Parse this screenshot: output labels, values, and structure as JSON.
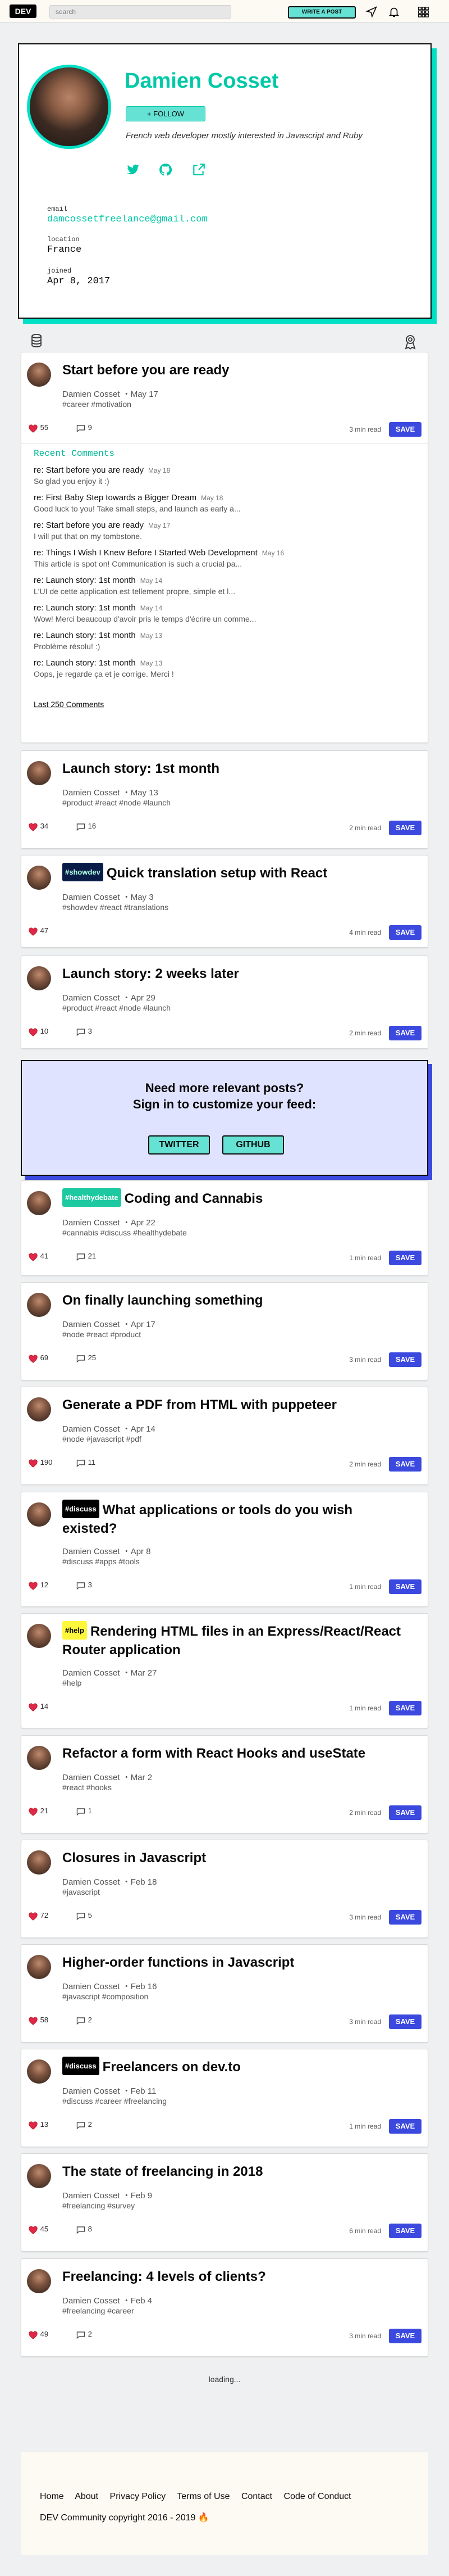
{
  "topbar": {
    "logo": "DEV",
    "search_placeholder": "search",
    "write_post": "WRITE A POST"
  },
  "profile": {
    "name": "Damien Cosset",
    "follow": "+ FOLLOW",
    "bio": "French web developer mostly interested in Javascript and Ruby",
    "email_label": "email",
    "email": "damcossetfreelance@gmail.com",
    "location_label": "location",
    "location": "France",
    "joined_label": "joined",
    "joined": "Apr 8, 2017"
  },
  "articles": [
    {
      "title": "Start before you are ready",
      "date": "Damien Cosset ・May 17",
      "tags": "#career #motivation",
      "reactions": "55",
      "comments": "9",
      "read": "3 min read",
      "save": "SAVE"
    },
    {
      "title": "Launch story: 1st month",
      "date": "Damien Cosset ・May 13",
      "tags": "#product #react #node #launch",
      "reactions": "34",
      "comments": "16",
      "read": "2 min read",
      "save": "SAVE"
    },
    {
      "badge": "#showdev",
      "title": "Quick translation setup with React",
      "date": "Damien Cosset ・May 3",
      "tags": "#showdev #react #translations",
      "reactions": "47",
      "comments": "",
      "read": "4 min read",
      "save": "SAVE"
    },
    {
      "title": "Launch story: 2 weeks later",
      "date": "Damien Cosset ・Apr 29",
      "tags": "#product #react #node #launch",
      "reactions": "10",
      "comments": "3",
      "read": "2 min read",
      "save": "SAVE"
    },
    {
      "badge": "#healthydebate",
      "title": "Coding and Cannabis",
      "date": "Damien Cosset ・Apr 22",
      "tags": "#cannabis #discuss #healthydebate",
      "reactions": "41",
      "comments": "21",
      "read": "1 min read",
      "save": "SAVE"
    },
    {
      "title": "On finally launching something",
      "date": "Damien Cosset ・Apr 17",
      "tags": "#node #react #product",
      "reactions": "69",
      "comments": "25",
      "read": "3 min read",
      "save": "SAVE"
    },
    {
      "title": "Generate a PDF from HTML with puppeteer",
      "date": "Damien Cosset ・Apr 14",
      "tags": "#node #javascript #pdf",
      "reactions": "190",
      "comments": "11",
      "read": "2 min read",
      "save": "SAVE"
    },
    {
      "badge": "#discuss",
      "title": "What applications or tools do you wish existed?",
      "date": "Damien Cosset ・Apr 8",
      "tags": "#discuss #apps #tools",
      "reactions": "12",
      "comments": "3",
      "read": "1 min read",
      "save": "SAVE"
    },
    {
      "badge": "#help",
      "title": "Rendering HTML files in an Express/React/React Router application",
      "date": "Damien Cosset ・Mar 27",
      "tags": "#help",
      "reactions": "14",
      "comments": "",
      "read": "1 min read",
      "save": "SAVE"
    },
    {
      "title": "Refactor a form with React Hooks and useState",
      "date": "Damien Cosset ・Mar 2",
      "tags": "#react #hooks",
      "reactions": "21",
      "comments": "1",
      "read": "2 min read",
      "save": "SAVE"
    },
    {
      "title": "Closures in Javascript",
      "date": "Damien Cosset ・Feb 18",
      "tags": "#javascript",
      "reactions": "72",
      "comments": "5",
      "read": "3 min read",
      "save": "SAVE"
    },
    {
      "title": "Higher-order functions in Javascript",
      "date": "Damien Cosset ・Feb 16",
      "tags": "#javascript #composition",
      "reactions": "58",
      "comments": "2",
      "read": "3 min read",
      "save": "SAVE"
    },
    {
      "badge": "#discuss",
      "title": "Freelancers on dev.to",
      "date": "Damien Cosset ・Feb 11",
      "tags": "#discuss #career #freelancing",
      "reactions": "13",
      "comments": "2",
      "read": "1 min read",
      "save": "SAVE"
    },
    {
      "title": "The state of freelancing in 2018",
      "date": "Damien Cosset ・Feb 9",
      "tags": "#freelancing #survey",
      "reactions": "45",
      "comments": "8",
      "read": "6 min read",
      "save": "SAVE"
    },
    {
      "title": "Freelancing: 4 levels of clients?",
      "date": "Damien Cosset ・Feb 4",
      "tags": "#freelancing #career",
      "reactions": "49",
      "comments": "2",
      "read": "3 min read",
      "save": "SAVE"
    }
  ],
  "recent": {
    "heading": "Recent Comments",
    "items": [
      {
        "t": "re: Start before you are ready",
        "d": "May 18",
        "s": "So glad you enjoy it :)"
      },
      {
        "t": "re: First Baby Step towards a Bigger Dream",
        "d": "May 18",
        "s": "Good luck to you! Take small steps, and launch as early a..."
      },
      {
        "t": "re: Start before you are ready",
        "d": "May 17",
        "s": "I will put that on my tombstone."
      },
      {
        "t": "re: Things I Wish I Knew Before I Started Web Development",
        "d": "May 16",
        "s": "This article is spot on! Communication is such a crucial pa..."
      },
      {
        "t": "re: Launch story: 1st month",
        "d": "May 14",
        "s": "L'UI de cette application est tellement propre, simple et l..."
      },
      {
        "t": "re: Launch story: 1st month",
        "d": "May 14",
        "s": "Wow! Merci beaucoup d'avoir pris le temps d'écrire un comme..."
      },
      {
        "t": "re: Launch story: 1st month",
        "d": "May 13",
        "s": "Problème résolu! :)"
      },
      {
        "t": "re: Launch story: 1st month",
        "d": "May 13",
        "s": "Oops, je regarde ça et je corrige. Merci !"
      }
    ],
    "last": "Last 250 Comments"
  },
  "cta": {
    "line1": "Need more relevant posts?",
    "line2": "Sign in to customize your feed:",
    "twitter": "TWITTER",
    "github": "GITHUB"
  },
  "loading": "loading...",
  "footer": {
    "links": [
      "Home",
      "About",
      "Privacy Policy",
      "Terms of Use",
      "Contact",
      "Code of Conduct"
    ],
    "copyright": "DEV Community copyright 2016 - 2019",
    "fire": "🔥"
  },
  "colors": {
    "accent": "#00c9a7",
    "save": "#3b49df",
    "cta_bg": "#e0e3ff"
  }
}
